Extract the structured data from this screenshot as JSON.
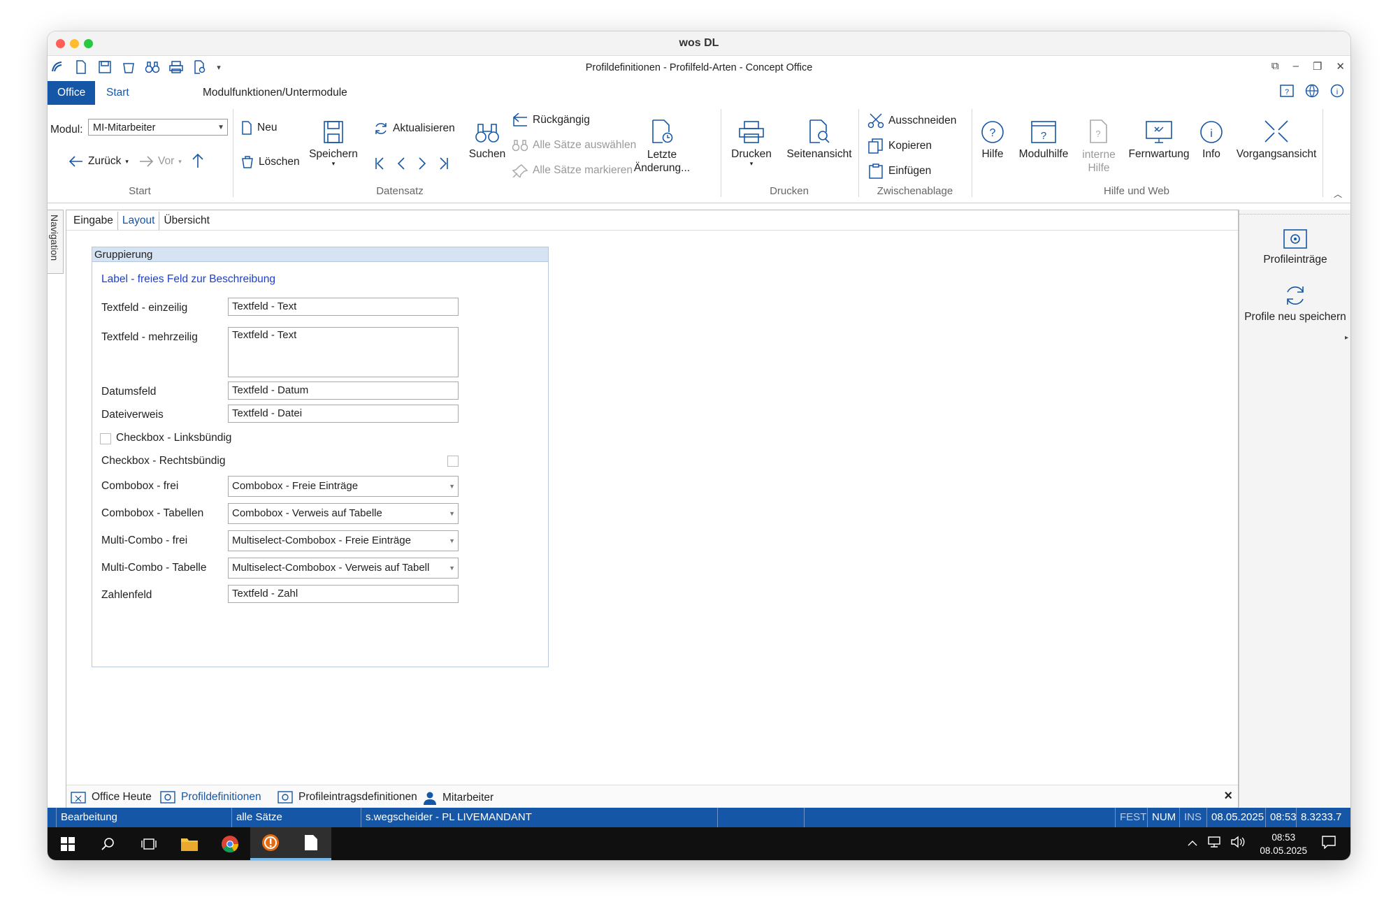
{
  "window": {
    "title": "wos DL"
  },
  "app": {
    "title": "Profildefinitionen - Profilfeld-Arten - Concept Office"
  },
  "window_controls": [
    "⧉",
    "–",
    "❐",
    "✕"
  ],
  "ribbon_tabs": {
    "office": "Office",
    "start": "Start",
    "modul": "Modulfunktionen/Untermodule"
  },
  "ribbon": {
    "start_group": {
      "label": "Start",
      "modul_label": "Modul:",
      "modul_value": "MI-Mitarbeiter",
      "back": "Zurück",
      "forward": "Vor"
    },
    "datensatz_group": {
      "label": "Datensatz",
      "neu": "Neu",
      "loeschen": "Löschen",
      "speichern": "Speichern",
      "aktualisieren": "Aktualisieren",
      "suchen": "Suchen",
      "rueckgaengig": "Rückgängig",
      "alle_auswaehlen": "Alle Sätze auswählen",
      "alle_markieren": "Alle Sätze markieren",
      "letzte_aenderung_1": "Letzte",
      "letzte_aenderung_2": "Änderung..."
    },
    "drucken_group": {
      "label": "Drucken",
      "drucken": "Drucken",
      "seitenansicht": "Seitenansicht"
    },
    "zwischenablage_group": {
      "label": "Zwischenablage",
      "ausschneiden": "Ausschneiden",
      "kopieren": "Kopieren",
      "einfuegen": "Einfügen"
    },
    "hilfe_group": {
      "label": "Hilfe und Web",
      "hilfe": "Hilfe",
      "modulhilfe": "Modulhilfe",
      "interne_hilfe_1": "interne",
      "interne_hilfe_2": "Hilfe",
      "fernwartung": "Fernwartung",
      "info": "Info",
      "vorgangsansicht": "Vorgangsansicht"
    }
  },
  "navigation_label": "Navigation",
  "subtabs": [
    "Eingabe",
    "Layout",
    "Übersicht"
  ],
  "group": {
    "title": "Gruppierung",
    "label_link": "Label - freies Feld zur Beschreibung",
    "fields": {
      "textfeld_einzeilig": {
        "label": "Textfeld - einzeilig",
        "value": "Textfeld - Text"
      },
      "textfeld_mehrzeilig": {
        "label": "Textfeld - mehrzeilig",
        "value": "Textfeld - Text"
      },
      "datumsfeld": {
        "label": "Datumsfeld",
        "value": "Textfeld - Datum"
      },
      "dateiverweis": {
        "label": "Dateiverweis",
        "value": "Textfeld - Datei"
      },
      "checkbox_links": {
        "label": "Checkbox - Linksbündig"
      },
      "checkbox_rechts": {
        "label": "Checkbox - Rechtsbündig"
      },
      "combobox_frei": {
        "label": "Combobox - frei",
        "value": "Combobox - Freie Einträge"
      },
      "combobox_tabellen": {
        "label": "Combobox - Tabellen",
        "value": "Combobox - Verweis auf Tabelle"
      },
      "multicombo_frei": {
        "label": "Multi-Combo - frei",
        "value": "Multiselect-Combobox - Freie Einträge"
      },
      "multicombo_tabelle": {
        "label": "Multi-Combo - Tabelle",
        "value": "Multiselect-Combobox - Verweis auf Tabell"
      },
      "zahlenfeld": {
        "label": "Zahlenfeld",
        "value": "Textfeld - Zahl"
      }
    }
  },
  "bottom_tabs": [
    "Office Heute",
    "Profildefinitionen",
    "Profileintragsdefinitionen",
    "Mitarbeiter"
  ],
  "bottom_close": "×",
  "right_panel": {
    "profileintraege": "Profileinträge",
    "profile_neu_speichern": "Profile neu speichern"
  },
  "statusbar": {
    "mode": "Bearbeitung",
    "filter": "alle Sätze",
    "user": "s.wegscheider - PL LIVEMANDANT",
    "fest": "FEST",
    "num": "NUM",
    "ins": "INS",
    "date": "08.05.2025",
    "time": "08:53",
    "version": "8.3233.7"
  },
  "taskbar": {
    "time": "08:53",
    "date": "08.05.2025"
  },
  "colors": {
    "accent": "#1556a7",
    "status_bar": "#1556a7",
    "taskbar": "#101010"
  }
}
